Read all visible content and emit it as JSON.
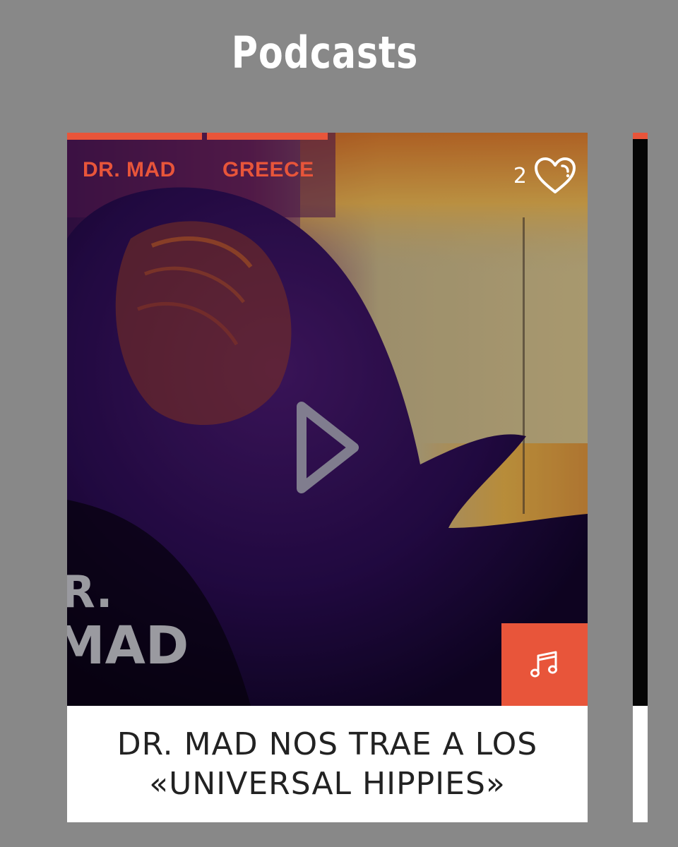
{
  "page": {
    "title": "Podcasts"
  },
  "card": {
    "tags": [
      "DR. MAD",
      "GREECE"
    ],
    "likes": "2",
    "watermark": "R.\nMAD",
    "title": "DR. MAD NOS TRAE A LOS «UNIVERSAL HIPPIES»",
    "icons": {
      "like": "heart-icon",
      "play": "play-icon",
      "type": "music-note-icon"
    }
  },
  "colors": {
    "background": "#888888",
    "accent": "#e8553a",
    "caption_bg": "#ffffff",
    "title_text": "#222222"
  }
}
